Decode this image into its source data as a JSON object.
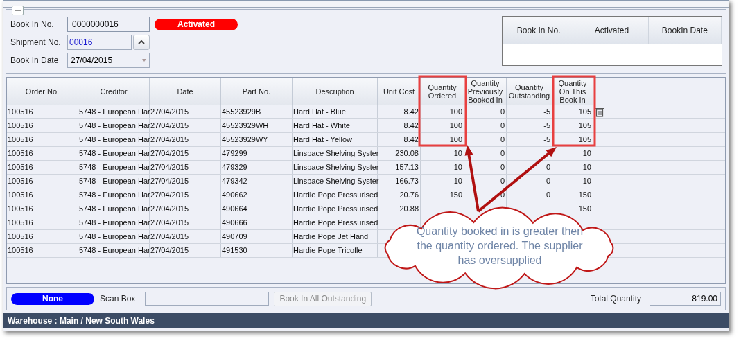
{
  "header": {
    "book_in_no": {
      "label": "Book In No.",
      "value": "0000000016"
    },
    "status": {
      "text": "Activated",
      "color": "#ff0000"
    },
    "shipment_no": {
      "label": "Shipment No.",
      "value": "00016"
    },
    "book_in_date": {
      "label": "Book In Date",
      "value": "27/04/2015"
    }
  },
  "lookup_grid": {
    "columns": [
      "Book In No.",
      "Activated",
      "BookIn Date"
    ]
  },
  "grid": {
    "columns": [
      "Order No.",
      "Creditor",
      "Date",
      "Part No.",
      "Description",
      "Unit Cost",
      "Quantity Ordered",
      "Quantity Previously Booked In",
      "Quantity Outstanding",
      "Quantity On This Book In"
    ],
    "rows": [
      {
        "cells": [
          "100516",
          "5748 - European Har",
          "27/04/2015",
          "45523929B",
          "Hard Hat - Blue",
          "8.42",
          "100",
          "0",
          "-5",
          "105"
        ],
        "deletable": true
      },
      {
        "cells": [
          "100516",
          "5748 - European Har",
          "27/04/2015",
          "45523929WH",
          "Hard Hat - White",
          "8.42",
          "100",
          "0",
          "-5",
          "105"
        ],
        "deletable": false
      },
      {
        "cells": [
          "100516",
          "5748 - European Har",
          "27/04/2015",
          "45523929WY",
          "Hard Hat - Yellow",
          "8.42",
          "100",
          "0",
          "-5",
          "105"
        ],
        "deletable": false
      },
      {
        "cells": [
          "100516",
          "5748 - European Har",
          "27/04/2015",
          "479299",
          "Linspace Shelving Syster",
          "230.08",
          "10",
          "0",
          null,
          "10"
        ],
        "deletable": false
      },
      {
        "cells": [
          "100516",
          "5748 - European Har",
          "27/04/2015",
          "479329",
          "Linspace Shelving Syster",
          "157.13",
          "10",
          "0",
          "0",
          "10"
        ],
        "deletable": false
      },
      {
        "cells": [
          "100516",
          "5748 - European Har",
          "27/04/2015",
          "479342",
          "Linspace Shelving Syster",
          "166.73",
          "10",
          "0",
          "0",
          "10"
        ],
        "deletable": false
      },
      {
        "cells": [
          "100516",
          "5748 - European Har",
          "27/04/2015",
          "490662",
          "Hardie Pope Pressurised",
          "20.76",
          "150",
          "0",
          "0",
          "150"
        ],
        "deletable": false
      },
      {
        "cells": [
          "100516",
          "5748 - European Har",
          "27/04/2015",
          "490664",
          "Hardie Pope Pressurised",
          "20.88",
          null,
          null,
          null,
          "150"
        ],
        "deletable": false
      },
      {
        "cells": [
          "100516",
          "5748 - European Har",
          "27/04/2015",
          "490666",
          "Hardie Pope Pressurised",
          null,
          null,
          null,
          null,
          null
        ],
        "deletable": false
      },
      {
        "cells": [
          "100516",
          "5748 - European Har",
          "27/04/2015",
          "490709",
          "Hardie Pope Jet Hand",
          null,
          null,
          null,
          null,
          null
        ],
        "deletable": false
      },
      {
        "cells": [
          "100516",
          "5748 - European Har",
          "27/04/2015",
          "491530",
          "Hardie Pope Tricofle",
          null,
          null,
          null,
          null,
          null
        ],
        "deletable": false
      }
    ]
  },
  "footer": {
    "mode": {
      "text": "None",
      "color": "#0000ff"
    },
    "scan_box_label": "Scan Box",
    "book_all_button": "Book In All Outstanding",
    "total_label": "Total Quantity",
    "total_value": "819.00"
  },
  "status_bar": "Warehouse : Main / New South Wales",
  "callout": {
    "text": "Quantity booked in is greater then the quantity ordered.  The supplier has oversupplied"
  }
}
